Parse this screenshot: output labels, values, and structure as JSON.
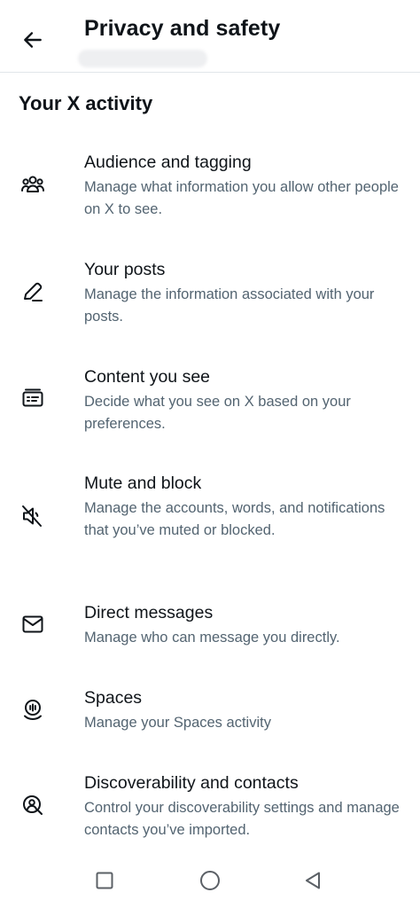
{
  "header": {
    "title": "Privacy and safety",
    "back_icon": "arrow-left-icon"
  },
  "section": {
    "title": "Your X activity"
  },
  "items": [
    {
      "label": "Audience and tagging",
      "description": "Manage what information you allow other people on X to see.",
      "icon": "people-icon"
    },
    {
      "label": "Your posts",
      "description": "Manage the information associated with your posts.",
      "icon": "pencil-icon"
    },
    {
      "label": "Content you see",
      "description": "Decide what you see on X based on your preferences.",
      "icon": "card-list-icon"
    },
    {
      "label": "Mute and block",
      "description": "Manage the accounts, words, and notifications that you’ve muted or blocked.",
      "icon": "speaker-muted-icon"
    },
    {
      "label": "Direct messages",
      "description": "Manage who can message you directly.",
      "icon": "envelope-icon"
    },
    {
      "label": "Spaces",
      "description": "Manage your Spaces activity",
      "icon": "spaces-mic-icon"
    },
    {
      "label": "Discoverability and contacts",
      "description": "Control your discoverability settings and manage contacts you’ve imported.",
      "icon": "person-search-icon"
    }
  ],
  "navbar": {
    "recents_icon": "square-icon",
    "home_icon": "circle-icon",
    "back_icon": "triangle-back-icon"
  },
  "colors": {
    "text_primary": "#0f1419",
    "text_secondary": "#536471",
    "divider": "#e1e6ea",
    "nav_icon": "#5b6066"
  }
}
